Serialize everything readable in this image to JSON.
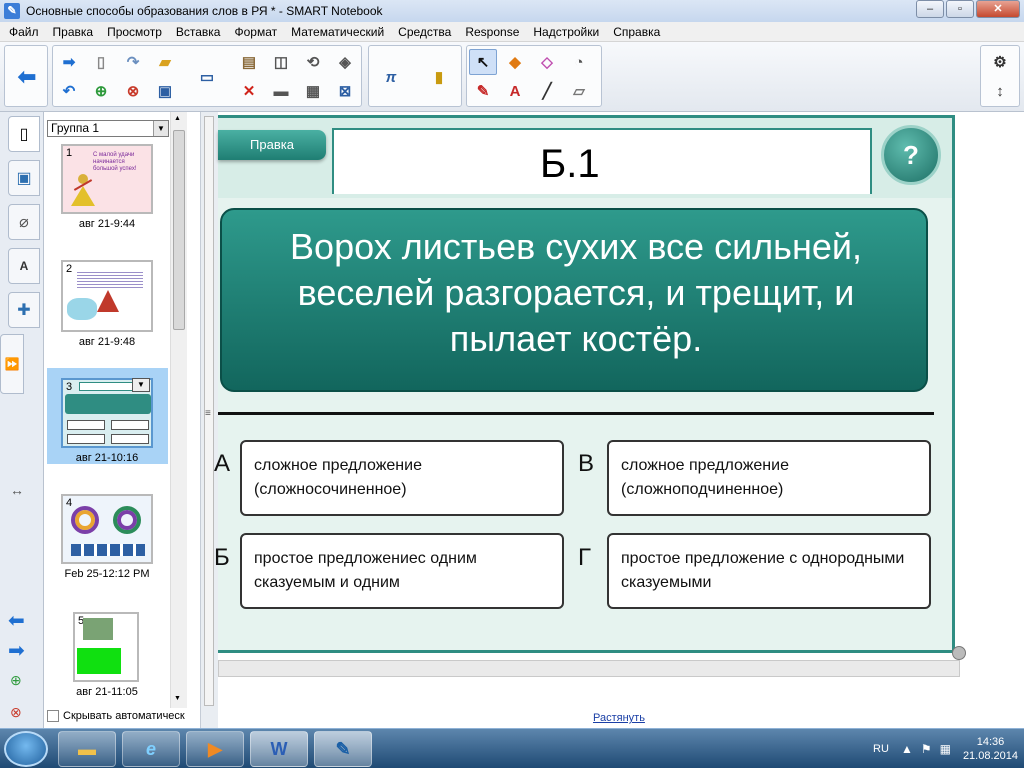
{
  "window": {
    "title": "Основные способы образования слов в РЯ * - SMART Notebook",
    "minimize": "–",
    "maximize": "▫",
    "close": "✕"
  },
  "menu": [
    "Файл",
    "Правка",
    "Просмотр",
    "Вставка",
    "Формат",
    "Математический",
    "Средства",
    "Response",
    "Надстройки",
    "Справка"
  ],
  "sorter": {
    "group": "Группа 1",
    "pages": [
      {
        "num": "1",
        "time": "авг 21-9:44",
        "caption": "С малой удачи начинается большой успех!"
      },
      {
        "num": "2",
        "time": "авг 21-9:48"
      },
      {
        "num": "3",
        "time": "авг 21-10:16"
      },
      {
        "num": "4",
        "time": "Feb 25-12:12 PM"
      },
      {
        "num": "5",
        "time": "авг 21-11:05"
      }
    ],
    "hide_auto": "Скрывать автоматическ"
  },
  "slide": {
    "pravka": "Правка",
    "title": "Б.1",
    "help": "?",
    "question": "Ворох листьев сухих все сильней, веселей разгорается, и трещит, и пылает костёр.",
    "answers": [
      {
        "letter": "А",
        "text": "сложное предложение (сложносочиненное)"
      },
      {
        "letter": "В",
        "text": "сложное предложение (сложноподчиненное)"
      },
      {
        "letter": "Б",
        "text": "простое предложениес одним сказуемым и одним"
      },
      {
        "letter": "Г",
        "text": "простое предложение с однородными сказуемыми"
      }
    ]
  },
  "canvas": {
    "stretch": "Растянуть"
  },
  "taskbar": {
    "lang": "RU",
    "time": "14:36",
    "date": "21.08.2014",
    "apps": [
      "explorer",
      "ie",
      "media-player",
      "word",
      "smart-notebook"
    ],
    "word_label": "W"
  },
  "colors": {
    "teal": "#2f8d82",
    "teal_dark": "#12665d"
  }
}
